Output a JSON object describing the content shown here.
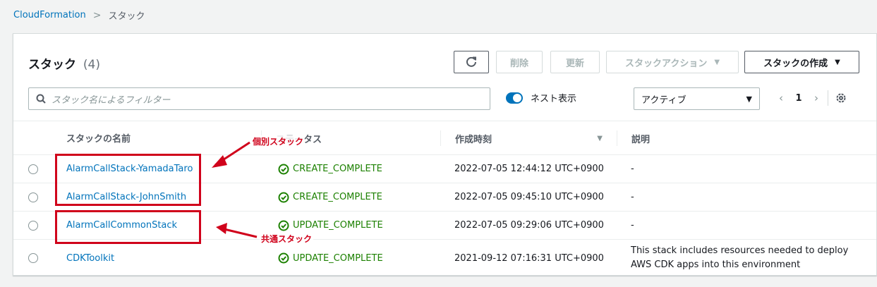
{
  "breadcrumb": {
    "root": "CloudFormation",
    "separator": ">",
    "current": "スタック"
  },
  "panel": {
    "title": "スタック",
    "count": "(4)"
  },
  "toolbar": {
    "delete_label": "削除",
    "update_label": "更新",
    "actions_label": "スタックアクション",
    "create_label": "スタックの作成"
  },
  "search": {
    "placeholder": "スタック名によるフィルター"
  },
  "toggle": {
    "label": "ネスト表示",
    "on": true
  },
  "filter_select": {
    "value": "アクティブ"
  },
  "pagination": {
    "page": "1"
  },
  "table": {
    "columns": [
      "スタックの名前",
      "ステータス",
      "作成時刻",
      "説明"
    ],
    "rows": [
      {
        "name": "AlarmCallStack-YamadaTaro",
        "status": "CREATE_COMPLETE",
        "created": "2022-07-05 12:44:12 UTC+0900",
        "description": "-"
      },
      {
        "name": "AlarmCallStack-JohnSmith",
        "status": "CREATE_COMPLETE",
        "created": "2022-07-05 09:45:10 UTC+0900",
        "description": "-"
      },
      {
        "name": "AlarmCallCommonStack",
        "status": "UPDATE_COMPLETE",
        "created": "2022-07-05 09:29:06 UTC+0900",
        "description": "-"
      },
      {
        "name": "CDKToolkit",
        "status": "UPDATE_COMPLETE",
        "created": "2021-09-12 07:16:31 UTC+0900",
        "description": "This stack includes resources needed to deploy AWS CDK apps into this environment"
      }
    ]
  },
  "annotations": {
    "individual": "個別スタック",
    "common": "共通スタック"
  },
  "colors": {
    "link": "#0073bb",
    "success": "#1d8102",
    "annotation": "#d0021b",
    "toggle_on": "#0073bb"
  }
}
